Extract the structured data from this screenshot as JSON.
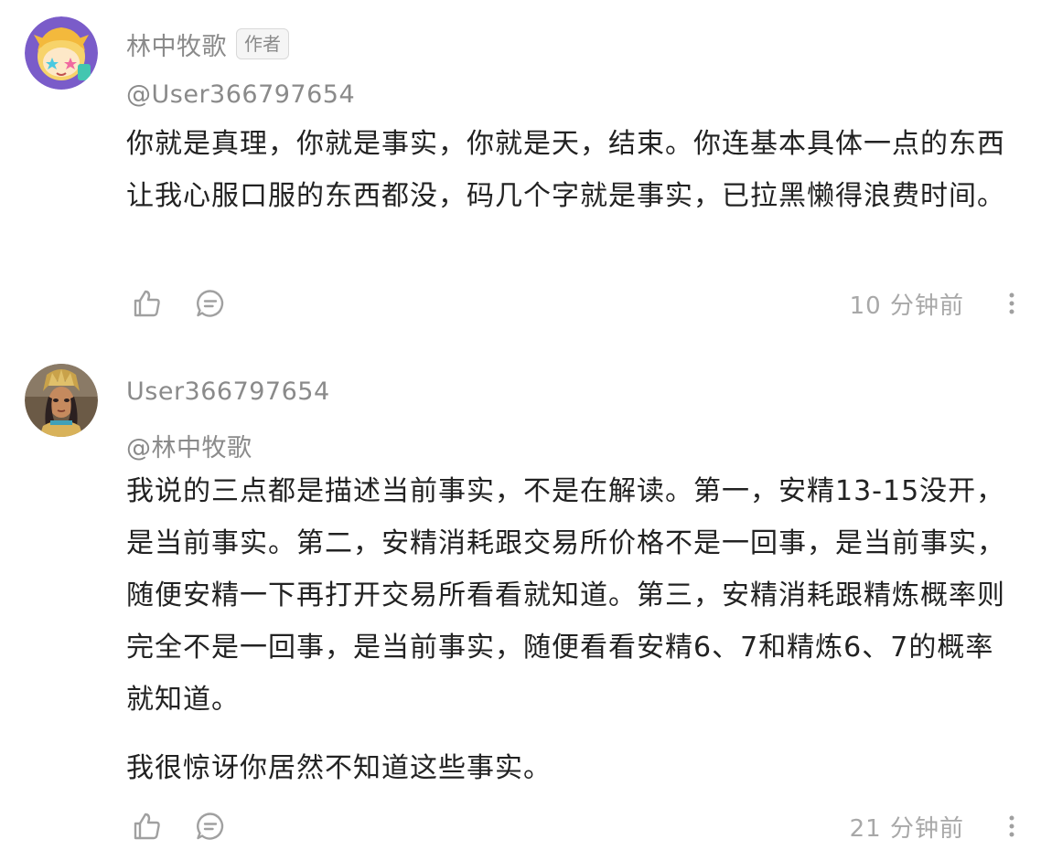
{
  "comments": [
    {
      "author": "林中牧歌",
      "badge": "作者",
      "reply_to": "@User366797654",
      "paragraphs": [
        "你就是真理，你就是事实，你就是天，结束。你连基本具体一点的东西让我心服口服的东西都没，码几个字就是事实，已拉黑懒得浪费时间。"
      ],
      "time": "10 分钟前",
      "avatar_icon": "cartoon-avatar-icon"
    },
    {
      "author": "User366797654",
      "badge": "",
      "reply_to": "@林中牧歌",
      "paragraphs": [
        "我说的三点都是描述当前事实，不是在解读。第一，安精13-15没开，是当前事实。第二，安精消耗跟交易所价格不是一回事，是当前事实，随便安精一下再打开交易所看看就知道。第三，安精消耗跟精炼概率则完全不是一回事，是当前事实，随便看看安精6、7和精炼6、7的概率就知道。",
        "我很惊讶你居然不知道这些事实。"
      ],
      "time": "21 分钟前",
      "avatar_icon": "game-character-avatar-icon"
    }
  ],
  "icons": {
    "like": "thumbs-up-icon",
    "reply": "comment-bubble-icon",
    "more": "more-vertical-icon"
  },
  "colors": {
    "text": "#222222",
    "muted": "#8a8a8a",
    "timestamp": "#a8a8a8",
    "icon": "#a0a0a0",
    "badge_bg": "#f5f5f5"
  }
}
